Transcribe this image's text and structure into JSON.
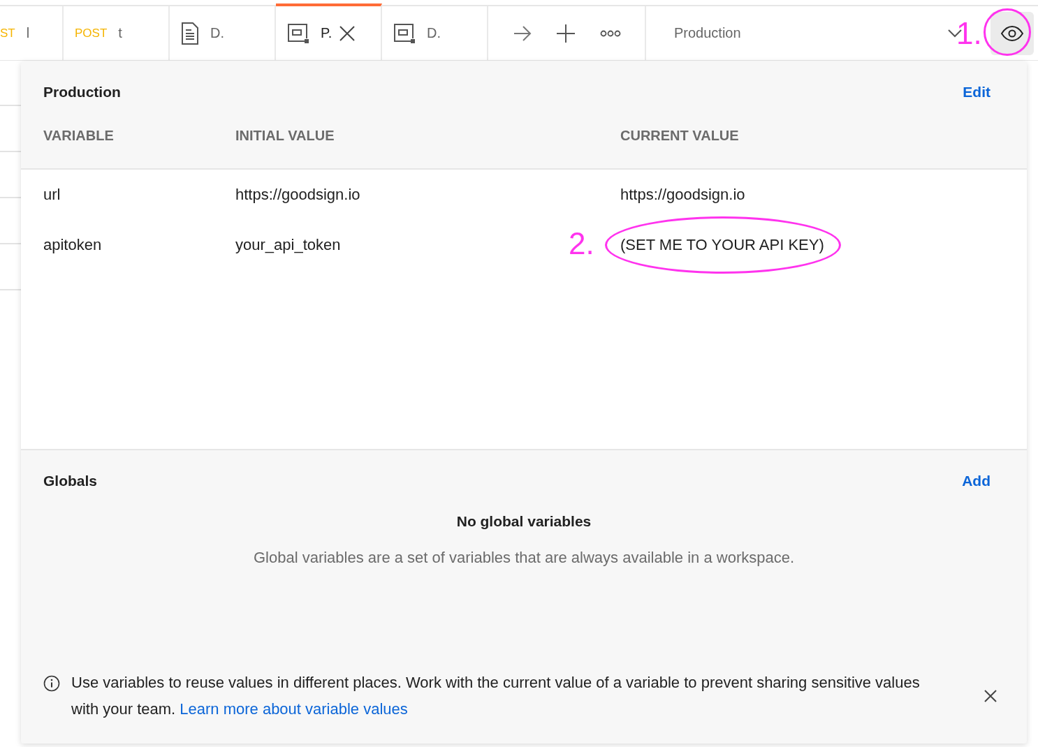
{
  "tabs": [
    {
      "kind": "request",
      "method": "ST",
      "label": "l",
      "selected": false,
      "closable": false
    },
    {
      "kind": "request",
      "method": "POST",
      "label": "t",
      "selected": false,
      "closable": false
    },
    {
      "kind": "document",
      "label": "D.",
      "selected": false,
      "closable": false
    },
    {
      "kind": "example",
      "label": "P.",
      "selected": true,
      "closable": true
    },
    {
      "kind": "example",
      "label": "D.",
      "selected": false,
      "closable": false
    }
  ],
  "environment": {
    "selected": "Production",
    "annotation": "1."
  },
  "environment_panel": {
    "title": "Production",
    "action": "Edit",
    "columns": [
      "VARIABLE",
      "INITIAL VALUE",
      "CURRENT VALUE"
    ],
    "rows": [
      {
        "variable": "url",
        "initial_value": "https://goodsign.io",
        "current_value": "https://goodsign.io",
        "highlighted": false
      },
      {
        "variable": "apitoken",
        "initial_value": "your_api_token",
        "current_value": "(SET ME TO YOUR API KEY)",
        "highlighted": true,
        "annotation": "2."
      }
    ]
  },
  "globals_panel": {
    "title": "Globals",
    "action": "Add",
    "empty_title": "No global variables",
    "empty_text": "Global variables are a set of variables that are always available in a workspace."
  },
  "info_banner": {
    "text": "Use variables to reuse values in different places. Work with the current value of a variable to prevent sharing sensitive values with your team.",
    "link": "Learn more about variable values"
  }
}
